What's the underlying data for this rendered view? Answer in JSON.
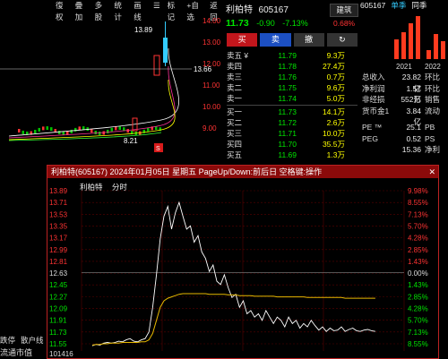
{
  "toolbar": {
    "items": [
      "復权",
      "疊加",
      "多股",
      "统计",
      "画线",
      "☰",
      "标记",
      "+自选",
      "返回"
    ]
  },
  "bgchart": {
    "price_labels": [
      "14.00",
      "13.00",
      "12.00",
      "11.00",
      "10.00",
      "9.00"
    ],
    "high_label": "13.89",
    "low_label": "8.21",
    "current_label": "13.66",
    "sell_tag": "S"
  },
  "order": {
    "name": "利柏特",
    "code": "605167",
    "price": "11.73",
    "change": "-0.90",
    "pct": "-7.13%",
    "trade_btn": "建筑",
    "trade_pct": "0.68%",
    "buy": "买",
    "sell": "卖",
    "cancel": "撤",
    "more": "↻",
    "asks": [
      {
        "l": "卖五 ¥",
        "p": "11.79",
        "v": "9.3万"
      },
      {
        "l": "卖四",
        "p": "11.78",
        "v": "27.4万"
      },
      {
        "l": "卖三",
        "p": "11.76",
        "v": "0.7万"
      },
      {
        "l": "卖二",
        "p": "11.75",
        "v": "9.6万"
      },
      {
        "l": "卖一",
        "p": "11.74",
        "v": "5.0万"
      }
    ],
    "bids": [
      {
        "l": "买一",
        "p": "11.73",
        "v": "14.1万"
      },
      {
        "l": "买二",
        "p": "11.72",
        "v": "2.6万"
      },
      {
        "l": "买三",
        "p": "11.71",
        "v": "10.0万"
      },
      {
        "l": "买四",
        "p": "11.70",
        "v": "35.5万"
      },
      {
        "l": "买五",
        "p": "11.69",
        "v": "1.3万"
      }
    ]
  },
  "info": {
    "code": "605167",
    "tab1": "单季",
    "tab2": "同季",
    "years": [
      "2021",
      "2022"
    ],
    "rows": [
      {
        "k": "总收入",
        "v": "23.82亿",
        "t": "环比"
      },
      {
        "k": "净利润",
        "v": "1.57亿",
        "t": "环比"
      },
      {
        "k": "非经损",
        "v": "552万",
        "t": "销售"
      },
      {
        "k": "货币金1",
        "v": "3.84亿",
        "t": "流动"
      }
    ],
    "rows2": [
      {
        "k": "PE ™",
        "v": "25.1",
        "t": "PB"
      },
      {
        "k": "PEG",
        "v": "0.52",
        "t": "PS"
      },
      {
        "k": "",
        "v": "15.36",
        "t": "净利"
      }
    ]
  },
  "bottom_left": {
    "tabs": [
      "跌停",
      "散户线"
    ],
    "market_value": "流通市值"
  },
  "popup": {
    "title": "利柏特(605167) 2024年01月05日 星期五 PageUp/Down:前后日 空格键:操作",
    "sub_name": "利柏特",
    "sub_mode": "分时",
    "prices": [
      "13.89",
      "13.71",
      "13.53",
      "13.35",
      "13.17",
      "12.99",
      "12.81",
      "12.63",
      "12.45",
      "12.27",
      "12.09",
      "11.91",
      "11.73",
      "11.55"
    ],
    "pcts": [
      "9.98%",
      "8.55%",
      "7.13%",
      "5.70%",
      "4.28%",
      "2.85%",
      "1.43%",
      "0.00%",
      "1.43%",
      "2.85%",
      "4.28%",
      "5.70%",
      "7.13%",
      "8.55%"
    ],
    "vol_label": "101416",
    "chart_data": {
      "type": "line",
      "ylim": [
        11.43,
        13.89
      ],
      "prev_close": 12.63,
      "series": [
        {
          "values": [
            11.51,
            11.53,
            11.52,
            11.55,
            11.56,
            11.55,
            11.56,
            11.58,
            11.57,
            11.6,
            11.62,
            11.58,
            11.57,
            11.6,
            11.62,
            11.72,
            12.1,
            12.6,
            13.15,
            13.5,
            13.65,
            13.3,
            13.55,
            13.71,
            13.5,
            13.3,
            13.35,
            13.1,
            13.2,
            12.95,
            12.85,
            12.65,
            12.75,
            12.5,
            12.45,
            12.6,
            12.4,
            12.25,
            12.3,
            12.1,
            12.2,
            12.0,
            12.05,
            11.95,
            12.0,
            11.9,
            12.05,
            11.95,
            11.85,
            11.95,
            11.9,
            11.8,
            11.95,
            11.85,
            11.9,
            11.78,
            11.85,
            11.8,
            11.9,
            11.82,
            11.75,
            11.8,
            11.73,
            11.78,
            11.74,
            11.75,
            11.8,
            11.73,
            11.76,
            11.78,
            11.74,
            11.73,
            11.75,
            11.76,
            11.74,
            11.73
          ]
        },
        {
          "values": [
            11.52,
            11.53,
            11.53,
            11.54,
            11.54,
            11.55,
            11.55,
            11.55,
            11.56,
            11.56,
            11.56,
            11.56,
            11.56,
            11.57,
            11.57,
            11.6,
            11.7,
            11.9,
            12.1,
            12.2,
            12.24,
            12.26,
            12.28,
            12.3,
            12.31,
            12.31,
            12.31,
            12.31,
            12.31,
            12.31,
            12.31,
            12.3,
            12.3,
            12.3,
            12.3,
            12.3,
            12.29,
            12.29,
            12.29,
            12.28,
            12.28,
            12.28,
            12.28,
            12.27,
            12.27,
            12.27,
            12.27,
            12.27,
            12.27,
            12.26,
            12.26,
            12.26,
            12.26,
            12.26,
            12.26,
            12.26,
            12.26,
            12.25,
            12.25,
            12.25,
            12.25,
            12.25,
            12.25,
            12.25,
            12.25,
            12.25,
            12.25,
            12.24,
            12.24,
            12.24,
            12.24,
            12.24,
            12.24,
            12.24,
            12.24,
            12.24
          ]
        }
      ]
    }
  }
}
